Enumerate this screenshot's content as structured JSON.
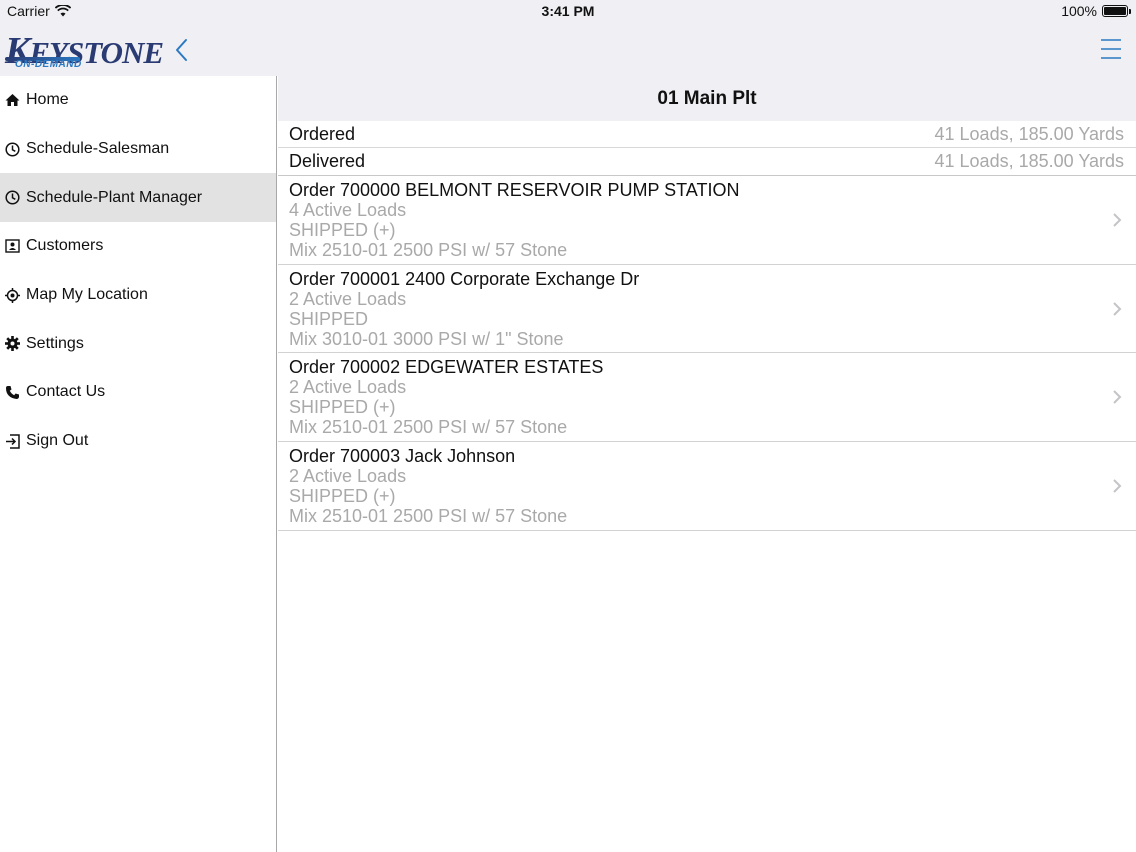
{
  "status_bar": {
    "carrier": "Carrier",
    "time": "3:41 PM",
    "battery": "100%"
  },
  "logo": {
    "k": "K",
    "rest": "EYSTONE",
    "sub": "ON-DEMAND"
  },
  "sidebar": {
    "items": [
      {
        "label": "Home",
        "icon": "home-icon"
      },
      {
        "label": "Schedule-Salesman",
        "icon": "clock-icon"
      },
      {
        "label": "Schedule-Plant Manager",
        "icon": "clock-icon",
        "active": true
      },
      {
        "label": "Customers",
        "icon": "contact-card-icon"
      },
      {
        "label": "Map My Location",
        "icon": "location-target-icon"
      },
      {
        "label": "Settings",
        "icon": "gear-icon"
      },
      {
        "label": "Contact Us",
        "icon": "phone-icon"
      },
      {
        "label": "Sign Out",
        "icon": "sign-out-icon"
      }
    ]
  },
  "main": {
    "title": "01 Main Plt",
    "summary": [
      {
        "label": "Ordered",
        "value": "41 Loads, 185.00 Yards"
      },
      {
        "label": "Delivered",
        "value": "41 Loads, 185.00 Yards"
      }
    ],
    "orders": [
      {
        "title": "Order 700000 BELMONT RESERVOIR PUMP STATION",
        "loads": "4 Active Loads",
        "status": "SHIPPED (+)",
        "mix": "Mix 2510-01 2500 PSI w/ 57 Stone"
      },
      {
        "title": "Order 700001 2400 Corporate Exchange Dr",
        "loads": "2 Active Loads",
        "status": "SHIPPED",
        "mix": "Mix 3010-01 3000 PSI w/ 1\" Stone"
      },
      {
        "title": "Order 700002 EDGEWATER ESTATES",
        "loads": "2 Active Loads",
        "status": "SHIPPED (+)",
        "mix": "Mix 2510-01 2500 PSI w/ 57 Stone"
      },
      {
        "title": "Order 700003 Jack Johnson",
        "loads": "2 Active Loads",
        "status": "SHIPPED (+)",
        "mix": "Mix 2510-01 2500 PSI w/ 57 Stone"
      }
    ]
  },
  "colors": {
    "accent": "#2b78c2",
    "bar_bg": "#efeff4",
    "secondary_text": "#a9a9a9",
    "active_row": "#e2e2e2",
    "logo_navy": "#2a3b73"
  }
}
